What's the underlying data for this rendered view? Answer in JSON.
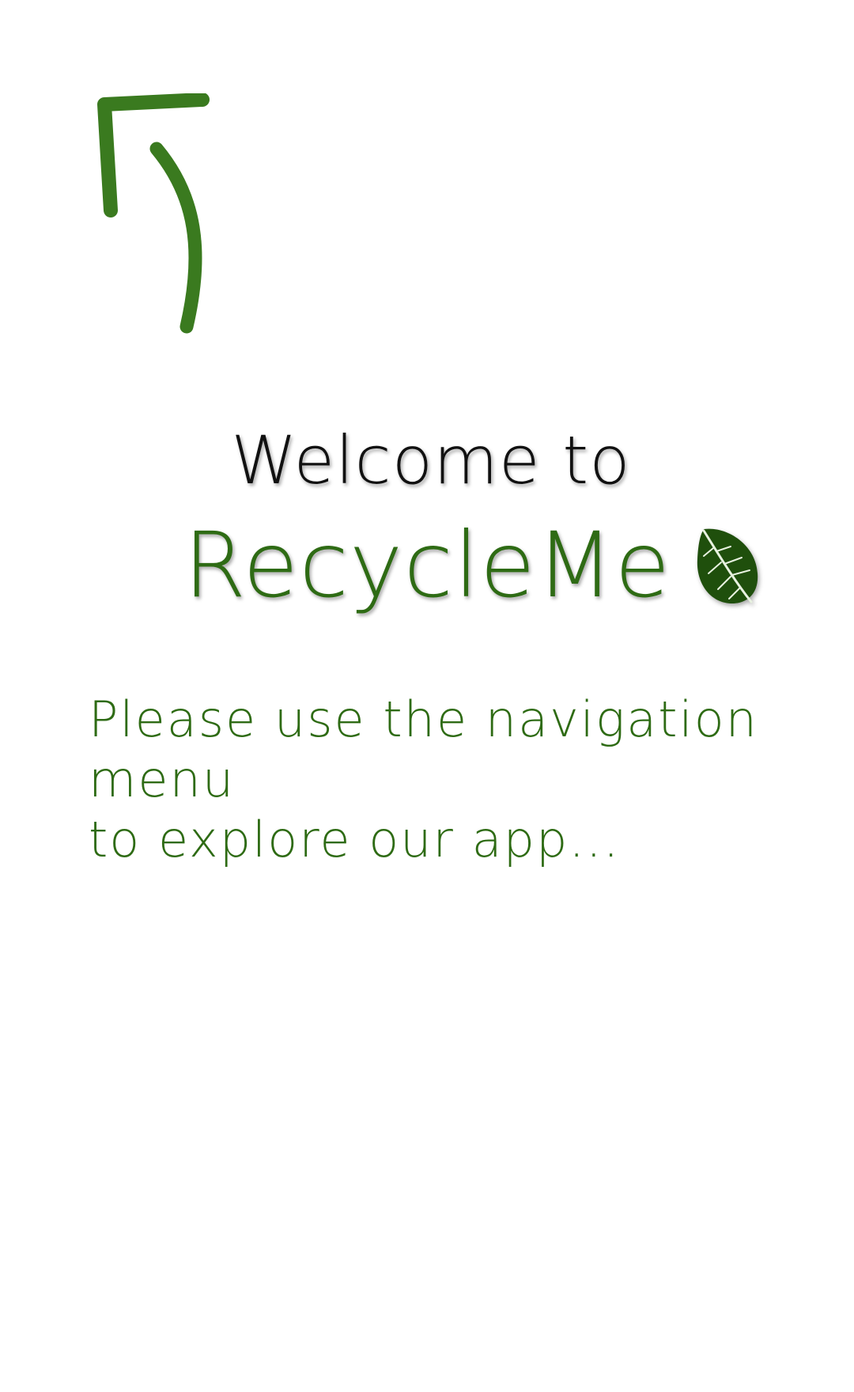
{
  "colors": {
    "brand_green": "#2e6b14",
    "arrow_green": "#3a7a1f",
    "leaf_green": "#1f4f0c",
    "text_dark": "#111111",
    "background": "#ffffff"
  },
  "hint": {
    "icon": "curved-arrow-up-left-icon"
  },
  "welcome": {
    "heading": "Welcome to",
    "brand": "RecycleMe",
    "brand_icon": "leaf-icon"
  },
  "tagline": {
    "line1": "Please use the navigation menu",
    "line2": "to explore our app..."
  }
}
